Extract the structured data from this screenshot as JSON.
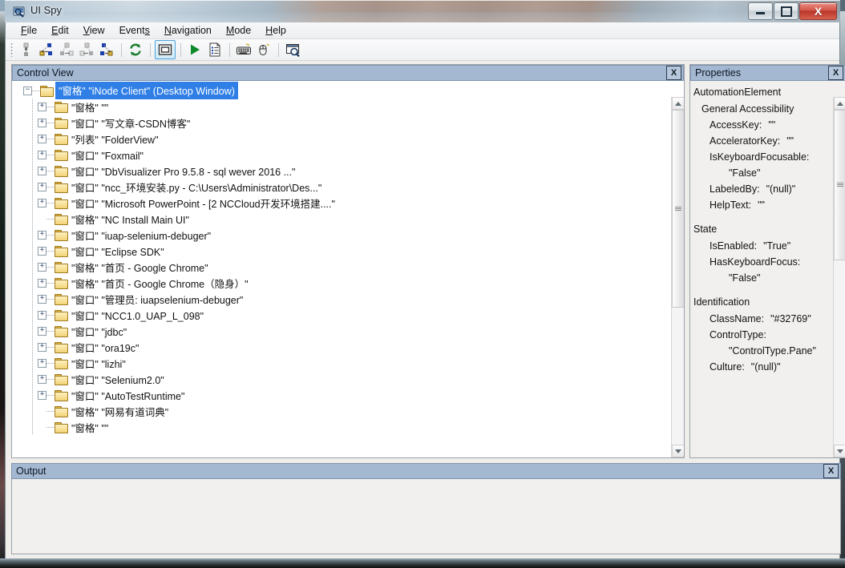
{
  "window": {
    "title": "UI Spy",
    "icon": "uispy-icon",
    "caption_buttons": {
      "minimize": "minimize-icon",
      "restore": "restore-icon",
      "close": "X"
    }
  },
  "menubar": {
    "items": [
      {
        "pre": "",
        "accel": "F",
        "post": "ile",
        "name": "menu-file"
      },
      {
        "pre": "",
        "accel": "E",
        "post": "dit",
        "name": "menu-edit"
      },
      {
        "pre": "",
        "accel": "V",
        "post": "iew",
        "name": "menu-view"
      },
      {
        "pre": "Event",
        "accel": "s",
        "post": "",
        "name": "menu-events"
      },
      {
        "pre": "",
        "accel": "N",
        "post": "avigation",
        "name": "menu-navigation"
      },
      {
        "pre": "",
        "accel": "M",
        "post": "ode",
        "name": "menu-mode"
      },
      {
        "pre": "",
        "accel": "H",
        "post": "elp",
        "name": "menu-help"
      }
    ]
  },
  "toolbar": {
    "buttons": [
      {
        "name": "navigate-parent-icon",
        "active": false
      },
      {
        "name": "navigate-previous-sibling-icon",
        "active": false
      },
      {
        "name": "navigate-first-child-icon",
        "active": false
      },
      {
        "name": "navigate-last-child-icon",
        "active": false
      },
      {
        "name": "navigate-next-sibling-icon",
        "active": false
      },
      {
        "name": "refresh-icon",
        "active": false
      },
      {
        "name": "highlight-rectangle-icon",
        "active": true
      },
      {
        "name": "play-icon",
        "active": false
      },
      {
        "name": "properties-list-icon",
        "active": false
      },
      {
        "name": "keyboard-icon",
        "active": false
      },
      {
        "name": "mouse-icon",
        "active": false
      },
      {
        "name": "find-icon",
        "active": false
      }
    ]
  },
  "control_view": {
    "header": "Control View",
    "close_label": "X",
    "tree": [
      {
        "type": "窗格",
        "value": "iNode Client",
        "suffix": " (Desktop Window)",
        "depth": 0,
        "expander": "minus",
        "selected": true
      },
      {
        "type": "窗格",
        "value": "",
        "suffix": "",
        "depth": 1,
        "expander": "plus",
        "selected": false
      },
      {
        "type": "窗口",
        "value": "写文章-CSDN博客",
        "suffix": "",
        "depth": 1,
        "expander": "plus",
        "selected": false
      },
      {
        "type": "列表",
        "value": "FolderView",
        "suffix": "",
        "depth": 1,
        "expander": "plus",
        "selected": false
      },
      {
        "type": "窗口",
        "value": "Foxmail",
        "suffix": "",
        "depth": 1,
        "expander": "plus",
        "selected": false
      },
      {
        "type": "窗口",
        "value": "DbVisualizer Pro 9.5.8 - sql wever 2016 ...",
        "suffix": "",
        "depth": 1,
        "expander": "plus",
        "selected": false
      },
      {
        "type": "窗口",
        "value": "ncc_环境安装.py - C:\\Users\\Administrator\\Des...",
        "suffix": "",
        "depth": 1,
        "expander": "plus",
        "selected": false
      },
      {
        "type": "窗口",
        "value": "Microsoft PowerPoint - [2 NCCloud开发环境搭建....",
        "suffix": "",
        "depth": 1,
        "expander": "plus",
        "selected": false
      },
      {
        "type": "窗格",
        "value": "NC Install Main UI",
        "suffix": "",
        "depth": 1,
        "expander": "none",
        "selected": false
      },
      {
        "type": "窗口",
        "value": "iuap-selenium-debuger",
        "suffix": "",
        "depth": 1,
        "expander": "plus",
        "selected": false
      },
      {
        "type": "窗口",
        "value": "Eclipse SDK",
        "suffix": "",
        "depth": 1,
        "expander": "plus",
        "selected": false
      },
      {
        "type": "窗格",
        "value": "首页 - Google Chrome",
        "suffix": "",
        "depth": 1,
        "expander": "plus",
        "selected": false
      },
      {
        "type": "窗格",
        "value": "首页 - Google Chrome（隐身）",
        "suffix": "",
        "depth": 1,
        "expander": "plus",
        "selected": false
      },
      {
        "type": "窗口",
        "value": "管理员: iuapselenium-debuger",
        "suffix": "",
        "depth": 1,
        "expander": "plus",
        "selected": false
      },
      {
        "type": "窗口",
        "value": "NCC1.0_UAP_L_098",
        "suffix": "",
        "depth": 1,
        "expander": "plus",
        "selected": false
      },
      {
        "type": "窗口",
        "value": "jdbc",
        "suffix": "",
        "depth": 1,
        "expander": "plus",
        "selected": false
      },
      {
        "type": "窗口",
        "value": "ora19c",
        "suffix": "",
        "depth": 1,
        "expander": "plus",
        "selected": false
      },
      {
        "type": "窗口",
        "value": "lizhi",
        "suffix": "",
        "depth": 1,
        "expander": "plus",
        "selected": false
      },
      {
        "type": "窗口",
        "value": "Selenium2.0",
        "suffix": "",
        "depth": 1,
        "expander": "plus",
        "selected": false
      },
      {
        "type": "窗口",
        "value": "AutoTestRuntime",
        "suffix": "",
        "depth": 1,
        "expander": "plus",
        "selected": false
      },
      {
        "type": "窗格",
        "value": "网易有道词典",
        "suffix": "",
        "depth": 1,
        "expander": "none",
        "selected": false
      },
      {
        "type": "窗格",
        "value": "",
        "suffix": "",
        "depth": 1,
        "expander": "none",
        "selected": false
      }
    ]
  },
  "properties": {
    "header": "Properties",
    "close_label": "X",
    "root": "AutomationElement",
    "sections": [
      {
        "title": "General Accessibility",
        "rows": [
          {
            "label": "AccessKey:",
            "value": "\"\"",
            "wrap": false
          },
          {
            "label": "AcceleratorKey:",
            "value": "\"\"",
            "wrap": false
          },
          {
            "label": "IsKeyboardFocusable:",
            "value": "\"False\"",
            "wrap": true
          },
          {
            "label": "LabeledBy:",
            "value": "\"(null)\"",
            "wrap": false
          },
          {
            "label": "HelpText:",
            "value": "\"\"",
            "wrap": false
          }
        ]
      },
      {
        "title": "State",
        "rows": [
          {
            "label": "IsEnabled:",
            "value": "\"True\"",
            "wrap": false
          },
          {
            "label": "HasKeyboardFocus:",
            "value": "\"False\"",
            "wrap": true
          }
        ]
      },
      {
        "title": "Identification",
        "rows": [
          {
            "label": "ClassName:",
            "value": "\"#32769\"",
            "wrap": false
          },
          {
            "label": "ControlType:",
            "value": "\"ControlType.Pane\"",
            "wrap": true
          },
          {
            "label": "Culture:",
            "value": "\"(null)\"",
            "wrap": false
          }
        ]
      }
    ]
  },
  "output": {
    "header": "Output",
    "close_label": "X",
    "content": ""
  },
  "colors": {
    "panel_header": "#a4b8d1",
    "selection": "#2f7fe6",
    "close_button": "#b83629",
    "toolbar_active": "#4ba3dd"
  }
}
